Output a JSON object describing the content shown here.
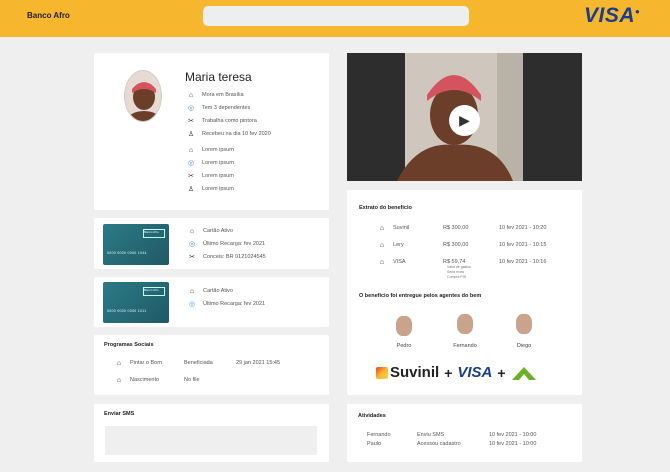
{
  "header": {
    "brand": "Banco Afro",
    "search_placeholder": "",
    "logo": "VISA"
  },
  "profile": {
    "name": "Maria teresa",
    "details": [
      {
        "icon": "home-icon",
        "text": "Mora em Brasília"
      },
      {
        "icon": "people-icon",
        "text": "Tem 3 dependentes"
      },
      {
        "icon": "tools-icon",
        "text": "Trabalha como pintora"
      },
      {
        "icon": "person-money-icon",
        "text": "Recebeu na dia 10 fev 2020"
      },
      {
        "icon": "home-icon",
        "text": "Lorem ipsum"
      },
      {
        "icon": "people-icon",
        "text": "Lorem ipsum"
      },
      {
        "icon": "tools-icon",
        "text": "Lorem ipsum"
      },
      {
        "icon": "person-money-icon",
        "text": "Lorem ipsum"
      }
    ]
  },
  "card1": {
    "brand": "Banco Afro",
    "number": "0000 0000 0000 1044",
    "lines": [
      {
        "icon": "home-icon",
        "text": "Cartão Ativo"
      },
      {
        "icon": "people-icon",
        "text": "Último Recarga: fev 2021"
      },
      {
        "icon": "tools-icon",
        "text": "Conceis: BR 0121024545"
      }
    ]
  },
  "card2": {
    "brand": "Banco Afro",
    "number": "0000 0000 0000 1011",
    "lines": [
      {
        "icon": "home-icon",
        "text": "Cartão Ativo"
      },
      {
        "icon": "people-icon",
        "text": "Último Recarga: fev 2021"
      }
    ]
  },
  "programs": {
    "title": "Programas Sociais",
    "rows": [
      {
        "icon": "home-icon",
        "name": "Pintar o Bom",
        "status": "Beneficiada",
        "date": "29 jan 2021 15:45"
      },
      {
        "icon": "home-icon",
        "name": "Nascimento",
        "status": "No file",
        "date": ""
      }
    ]
  },
  "sms": {
    "title": "Enviar SMS"
  },
  "benefit": {
    "title": "Extrato do benefício",
    "rows": [
      {
        "icon": "home-icon",
        "name": "Suvinil",
        "value": "R$ 300,00",
        "date": "10 fev 2021 - 10:20"
      },
      {
        "icon": "home-icon",
        "name": "Lery",
        "value": "R$ 300,00",
        "date": "10 fev 2021 - 10:15"
      },
      {
        "icon": "home-icon",
        "name": "VISA",
        "value": "R$ 59,74",
        "date": "10 fev 2021 - 10:16"
      }
    ],
    "breakdown": [
      "Valor de gastos",
      "Seria extra",
      "Compra PIS"
    ],
    "agents_title": "O benefício foi entregue pelos agentes do bem",
    "agents": [
      "Pedro",
      "Fernando",
      "Diego"
    ],
    "partners": [
      "Suvinil",
      "VISA",
      "Leroy"
    ]
  },
  "activities": {
    "title": "Atividades",
    "rows": [
      {
        "name": "Fernando",
        "action": "Enviu SMS",
        "date": "10 fev 2021 - 10:00"
      },
      {
        "name": "Paulo",
        "action": "Acessou cadastro",
        "date": "10 fev 2021 - 10:00"
      }
    ]
  },
  "video": {
    "play_icon": "play-icon"
  },
  "colors": {
    "header": "#f6b72e",
    "visa_blue": "#1a3e8c",
    "card_teal": "#2c7a86"
  }
}
